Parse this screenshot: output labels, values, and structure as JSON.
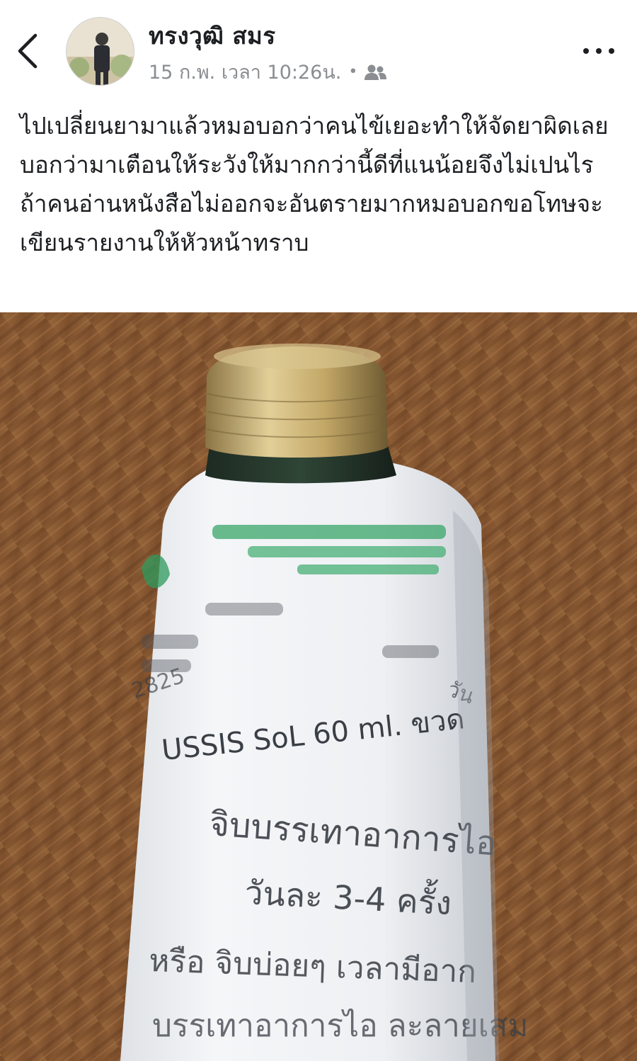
{
  "post": {
    "author": "ทรงวุฒิ สมร",
    "timestamp": "15 ก.พ. เวลา 10:26น.",
    "separator": "•",
    "audience_icon": "friends-icon",
    "text": "ไปเปลี่ยนยามาแล้วหมอบอกว่าคนไข้เยอะทำให้จัดยาผิดเลยบอกว่ามาเตือนให้ระวังให้มากกว่านี้ดีที่แนน้อยจึงไม่เปนไรถ้าคนอ่านหนังสือไม่ออกจะอันตรายมากหมอบอกขอโทษจะเขียนรายงานให้หัวหน้าทราบ"
  },
  "header": {
    "back_icon": "chevron-left-icon",
    "more_icon": "more-horizontal-icon"
  },
  "photo": {
    "label": {
      "code": "2825",
      "drug_line": "USSIS SoL 60 ml. ขวด",
      "side_text": "วัน",
      "line1": "จิบบรรเทาอาการไอ",
      "line2": "วันละ 3-4 ครั้ง",
      "line3": "หรือ จิบบ่อยๆ เวลามีอาก",
      "line4": "บรรเทาอาการไอ ละลายเสม"
    }
  },
  "colors": {
    "text": "#1c1e21",
    "meta": "#8a8d91",
    "label_green": "#2e9a5c",
    "cap_gold": "#b89b5e",
    "wood": "#8a5a33"
  }
}
